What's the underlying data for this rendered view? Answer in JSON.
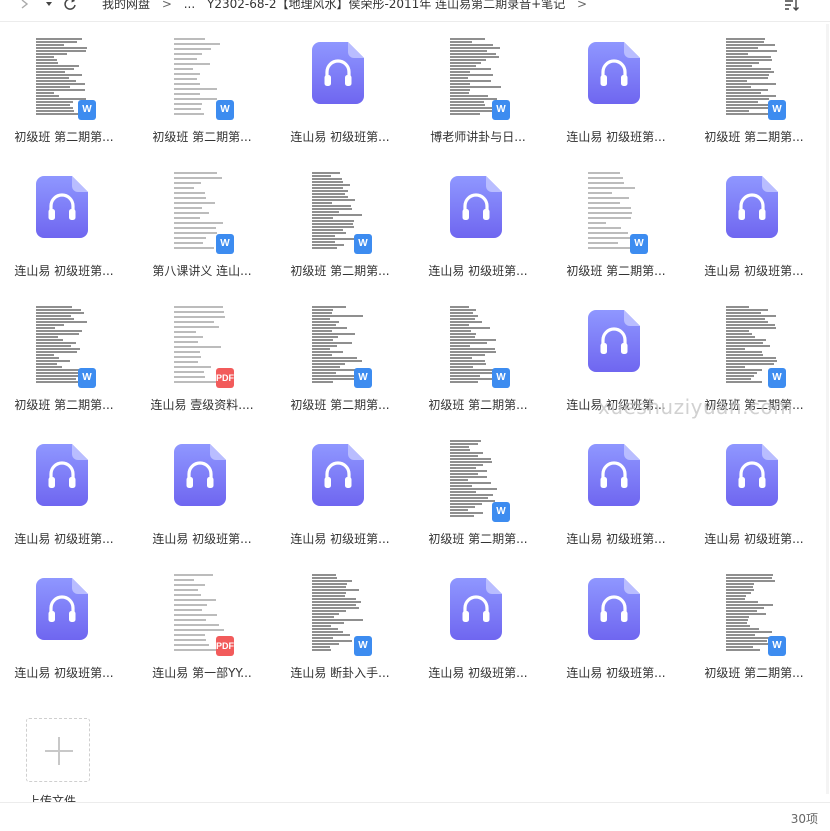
{
  "toolbar": {
    "back_icon": "chevron-right-icon",
    "dropdown_icon": "caret-down-icon",
    "refresh_icon": "refresh-icon",
    "sort_icon": "sort-icon"
  },
  "breadcrumb": {
    "root": "我的网盘",
    "sep1": ">",
    "ellipsis": "...",
    "current": "Y2302-68-2【地理风水】侯荣彤-2011年 连山易第二期录音+笔记",
    "sep2": ">"
  },
  "files": [
    {
      "name": "初级班 第二期第...",
      "kind": "word"
    },
    {
      "name": "初级班 第二期第...",
      "kind": "word"
    },
    {
      "name": "连山易 初级班第...",
      "kind": "audio"
    },
    {
      "name": "博老师讲卦与日...",
      "kind": "word"
    },
    {
      "name": "连山易 初级班第...",
      "kind": "audio"
    },
    {
      "name": "初级班 第二期第...",
      "kind": "word"
    },
    {
      "name": "连山易 初级班第...",
      "kind": "audio"
    },
    {
      "name": "第八课讲义 连山...",
      "kind": "word"
    },
    {
      "name": "初级班 第二期第...",
      "kind": "word"
    },
    {
      "name": "连山易 初级班第...",
      "kind": "audio"
    },
    {
      "name": "初级班 第二期第...",
      "kind": "word"
    },
    {
      "name": "连山易 初级班第...",
      "kind": "audio"
    },
    {
      "name": "初级班 第二期第...",
      "kind": "word"
    },
    {
      "name": "连山易 壹级资料....",
      "kind": "pdf"
    },
    {
      "name": "初级班 第二期第...",
      "kind": "word"
    },
    {
      "name": "初级班 第二期第...",
      "kind": "word"
    },
    {
      "name": "连山易 初级班第...",
      "kind": "audio"
    },
    {
      "name": "初级班 第二期第...",
      "kind": "word"
    },
    {
      "name": "连山易 初级班第...",
      "kind": "audio"
    },
    {
      "name": "连山易 初级班第...",
      "kind": "audio"
    },
    {
      "name": "连山易 初级班第...",
      "kind": "audio"
    },
    {
      "name": "初级班 第二期第...",
      "kind": "word"
    },
    {
      "name": "连山易 初级班第...",
      "kind": "audio"
    },
    {
      "name": "连山易 初级班第...",
      "kind": "audio"
    },
    {
      "name": "连山易 初级班第...",
      "kind": "audio"
    },
    {
      "name": "连山易 第一部YY...",
      "kind": "pdf"
    },
    {
      "name": "连山易 断卦入手...",
      "kind": "word"
    },
    {
      "name": "连山易 初级班第...",
      "kind": "audio"
    },
    {
      "name": "连山易 初级班第...",
      "kind": "audio"
    },
    {
      "name": "初级班 第二期第...",
      "kind": "word"
    }
  ],
  "badges": {
    "word": "W",
    "pdf": "PDF"
  },
  "add_tile": {
    "icon": "plus-icon",
    "label": "上传文件"
  },
  "watermark": "xueshuziyuan.com",
  "status": {
    "count": "30项"
  },
  "colors": {
    "audio_gradient_top": "#8f97ff",
    "audio_gradient_bottom": "#6f66f0",
    "word_badge": "#3d8cf0",
    "pdf_badge": "#f25b5b"
  }
}
